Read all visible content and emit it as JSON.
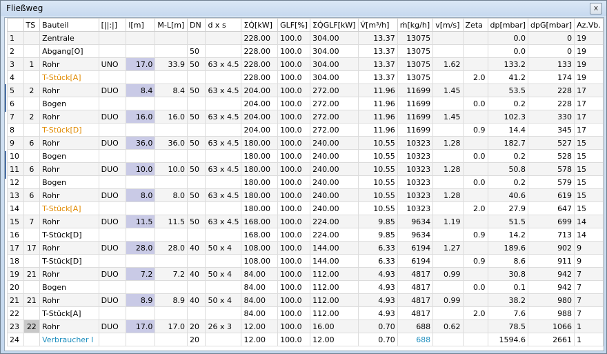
{
  "window": {
    "title": "Fließweg",
    "close_label": "x"
  },
  "columns": [
    "",
    "TS",
    "Bauteil",
    "[||:|]",
    "l[m]",
    "M-L[m]",
    "DN",
    "d x s",
    "ΣQ̇[kW]",
    "GLF[%]",
    "ΣQ̇GLF[kW]",
    "V̇[m³/h]",
    "ṁ[kg/h]",
    "v[m/s]",
    "Zeta",
    "dp[mbar]",
    "dpG[mbar]",
    "Az.Vb."
  ],
  "rows": [
    {
      "nr": "1",
      "ts": "",
      "bauteil": "Zentrale",
      "typ": "",
      "l": "",
      "ml": "",
      "dn": "",
      "dxs": "",
      "q": "228.00",
      "glf": "100.0",
      "qglf": "304.00",
      "v": "13.37",
      "m": "13075",
      "vel": "",
      "zeta": "",
      "dp": "0.0",
      "dpg": "0",
      "az": "19"
    },
    {
      "nr": "2",
      "ts": "",
      "bauteil": "Abgang[O]",
      "typ": "",
      "l": "",
      "ml": "",
      "dn": "50",
      "dxs": "",
      "q": "228.00",
      "glf": "100.0",
      "qglf": "304.00",
      "v": "13.37",
      "m": "13075",
      "vel": "",
      "zeta": "",
      "dp": "0.0",
      "dpg": "0",
      "az": "19"
    },
    {
      "nr": "3",
      "ts": "1",
      "bauteil": "Rohr",
      "typ": "UNO",
      "l": "17.0",
      "ml": "33.9",
      "dn": "50",
      "dxs": "63 x 4.5",
      "q": "228.00",
      "glf": "100.0",
      "qglf": "304.00",
      "v": "13.37",
      "m": "13075",
      "vel": "1.62",
      "zeta": "",
      "dp": "133.2",
      "dpg": "133",
      "az": "19"
    },
    {
      "nr": "4",
      "ts": "",
      "bauteil": "T-Stück[A]",
      "color": "orange",
      "typ": "",
      "l": "",
      "ml": "",
      "dn": "",
      "dxs": "",
      "q": "228.00",
      "glf": "100.0",
      "qglf": "304.00",
      "v": "13.37",
      "m": "13075",
      "vel": "",
      "zeta": "2.0",
      "dp": "41.2",
      "dpg": "174",
      "az": "19"
    },
    {
      "nr": "5",
      "ts": "2",
      "bauteil": "Rohr",
      "typ": "DUO",
      "l": "8.4",
      "ml": "8.4",
      "dn": "50",
      "dxs": "63 x 4.5",
      "q": "204.00",
      "glf": "100.0",
      "qglf": "272.00",
      "v": "11.96",
      "m": "11699",
      "vel": "1.45",
      "zeta": "",
      "dp": "53.5",
      "dpg": "228",
      "az": "17"
    },
    {
      "nr": "6",
      "ts": "",
      "bauteil": "Bogen",
      "typ": "",
      "l": "",
      "ml": "",
      "dn": "",
      "dxs": "",
      "q": "204.00",
      "glf": "100.0",
      "qglf": "272.00",
      "v": "11.96",
      "m": "11699",
      "vel": "",
      "zeta": "0.0",
      "dp": "0.2",
      "dpg": "228",
      "az": "17"
    },
    {
      "nr": "7",
      "ts": "2",
      "bauteil": "Rohr",
      "typ": "DUO",
      "l": "16.0",
      "ml": "16.0",
      "dn": "50",
      "dxs": "63 x 4.5",
      "q": "204.00",
      "glf": "100.0",
      "qglf": "272.00",
      "v": "11.96",
      "m": "11699",
      "vel": "1.45",
      "zeta": "",
      "dp": "102.3",
      "dpg": "330",
      "az": "17"
    },
    {
      "nr": "8",
      "ts": "",
      "bauteil": "T-Stück[D]",
      "color": "orange",
      "typ": "",
      "l": "",
      "ml": "",
      "dn": "",
      "dxs": "",
      "q": "204.00",
      "glf": "100.0",
      "qglf": "272.00",
      "v": "11.96",
      "m": "11699",
      "vel": "",
      "zeta": "0.9",
      "dp": "14.4",
      "dpg": "345",
      "az": "17"
    },
    {
      "nr": "9",
      "ts": "6",
      "bauteil": "Rohr",
      "typ": "DUO",
      "l": "36.0",
      "ml": "36.0",
      "dn": "50",
      "dxs": "63 x 4.5",
      "q": "180.00",
      "glf": "100.0",
      "qglf": "240.00",
      "v": "10.55",
      "m": "10323",
      "vel": "1.28",
      "zeta": "",
      "dp": "182.7",
      "dpg": "527",
      "az": "15"
    },
    {
      "nr": "10",
      "ts": "",
      "bauteil": "Bogen",
      "typ": "",
      "l": "",
      "ml": "",
      "dn": "",
      "dxs": "",
      "q": "180.00",
      "glf": "100.0",
      "qglf": "240.00",
      "v": "10.55",
      "m": "10323",
      "vel": "",
      "zeta": "0.0",
      "dp": "0.2",
      "dpg": "528",
      "az": "15"
    },
    {
      "nr": "11",
      "ts": "6",
      "bauteil": "Rohr",
      "typ": "DUO",
      "l": "10.0",
      "ml": "10.0",
      "dn": "50",
      "dxs": "63 x 4.5",
      "q": "180.00",
      "glf": "100.0",
      "qglf": "240.00",
      "v": "10.55",
      "m": "10323",
      "vel": "1.28",
      "zeta": "",
      "dp": "50.8",
      "dpg": "578",
      "az": "15"
    },
    {
      "nr": "12",
      "ts": "",
      "bauteil": "Bogen",
      "typ": "",
      "l": "",
      "ml": "",
      "dn": "",
      "dxs": "",
      "q": "180.00",
      "glf": "100.0",
      "qglf": "240.00",
      "v": "10.55",
      "m": "10323",
      "vel": "",
      "zeta": "0.0",
      "dp": "0.2",
      "dpg": "579",
      "az": "15"
    },
    {
      "nr": "13",
      "ts": "6",
      "bauteil": "Rohr",
      "typ": "DUO",
      "l": "8.0",
      "ml": "8.0",
      "dn": "50",
      "dxs": "63 x 4.5",
      "q": "180.00",
      "glf": "100.0",
      "qglf": "240.00",
      "v": "10.55",
      "m": "10323",
      "vel": "1.28",
      "zeta": "",
      "dp": "40.6",
      "dpg": "619",
      "az": "15"
    },
    {
      "nr": "14",
      "ts": "",
      "bauteil": "T-Stück[A]",
      "color": "orange",
      "typ": "",
      "l": "",
      "ml": "",
      "dn": "",
      "dxs": "",
      "q": "180.00",
      "glf": "100.0",
      "qglf": "240.00",
      "v": "10.55",
      "m": "10323",
      "vel": "",
      "zeta": "2.0",
      "dp": "27.9",
      "dpg": "647",
      "az": "15"
    },
    {
      "nr": "15",
      "ts": "7",
      "bauteil": "Rohr",
      "typ": "DUO",
      "l": "11.5",
      "ml": "11.5",
      "dn": "50",
      "dxs": "63 x 4.5",
      "q": "168.00",
      "glf": "100.0",
      "qglf": "224.00",
      "v": "9.85",
      "m": "9634",
      "vel": "1.19",
      "zeta": "",
      "dp": "51.5",
      "dpg": "699",
      "az": "14"
    },
    {
      "nr": "16",
      "ts": "",
      "bauteil": "T-Stück[D]",
      "typ": "",
      "l": "",
      "ml": "",
      "dn": "",
      "dxs": "",
      "q": "168.00",
      "glf": "100.0",
      "qglf": "224.00",
      "v": "9.85",
      "m": "9634",
      "vel": "",
      "zeta": "0.9",
      "dp": "14.2",
      "dpg": "713",
      "az": "14"
    },
    {
      "nr": "17",
      "ts": "17",
      "bauteil": "Rohr",
      "typ": "DUO",
      "l": "28.0",
      "ml": "28.0",
      "dn": "40",
      "dxs": "50 x 4",
      "q": "108.00",
      "glf": "100.0",
      "qglf": "144.00",
      "v": "6.33",
      "m": "6194",
      "vel": "1.27",
      "zeta": "",
      "dp": "189.6",
      "dpg": "902",
      "az": "9"
    },
    {
      "nr": "18",
      "ts": "",
      "bauteil": "T-Stück[D]",
      "typ": "",
      "l": "",
      "ml": "",
      "dn": "",
      "dxs": "",
      "q": "108.00",
      "glf": "100.0",
      "qglf": "144.00",
      "v": "6.33",
      "m": "6194",
      "vel": "",
      "zeta": "0.9",
      "dp": "8.6",
      "dpg": "911",
      "az": "9"
    },
    {
      "nr": "19",
      "ts": "21",
      "bauteil": "Rohr",
      "typ": "DUO",
      "l": "7.2",
      "ml": "7.2",
      "dn": "40",
      "dxs": "50 x 4",
      "q": "84.00",
      "glf": "100.0",
      "qglf": "112.00",
      "v": "4.93",
      "m": "4817",
      "vel": "0.99",
      "zeta": "",
      "dp": "30.8",
      "dpg": "942",
      "az": "7"
    },
    {
      "nr": "20",
      "ts": "",
      "bauteil": "Bogen",
      "typ": "",
      "l": "",
      "ml": "",
      "dn": "",
      "dxs": "",
      "q": "84.00",
      "glf": "100.0",
      "qglf": "112.00",
      "v": "4.93",
      "m": "4817",
      "vel": "",
      "zeta": "0.0",
      "dp": "0.1",
      "dpg": "942",
      "az": "7"
    },
    {
      "nr": "21",
      "ts": "21",
      "bauteil": "Rohr",
      "typ": "DUO",
      "l": "8.9",
      "ml": "8.9",
      "dn": "40",
      "dxs": "50 x 4",
      "q": "84.00",
      "glf": "100.0",
      "qglf": "112.00",
      "v": "4.93",
      "m": "4817",
      "vel": "0.99",
      "zeta": "",
      "dp": "38.2",
      "dpg": "980",
      "az": "7"
    },
    {
      "nr": "22",
      "ts": "",
      "bauteil": "T-Stück[A]",
      "typ": "",
      "l": "",
      "ml": "",
      "dn": "",
      "dxs": "",
      "q": "84.00",
      "glf": "100.0",
      "qglf": "112.00",
      "v": "4.93",
      "m": "4817",
      "vel": "",
      "zeta": "2.0",
      "dp": "7.6",
      "dpg": "988",
      "az": "7"
    },
    {
      "nr": "23",
      "ts": "22",
      "ts_selected": true,
      "bauteil": "Rohr",
      "typ": "DUO",
      "l": "17.0",
      "ml": "17.0",
      "dn": "20",
      "dxs": "26 x 3",
      "q": "12.00",
      "glf": "100.0",
      "qglf": "16.00",
      "v": "0.70",
      "m": "688",
      "vel": "0.62",
      "zeta": "",
      "dp": "78.5",
      "dpg": "1066",
      "az": "1"
    },
    {
      "nr": "24",
      "ts": "",
      "bauteil": "Verbraucher I",
      "color": "cyan",
      "m_color": "cyan",
      "typ": "",
      "l": "",
      "ml": "",
      "dn": "20",
      "dxs": "",
      "q": "12.00",
      "glf": "100.0",
      "qglf": "12.00",
      "v": "0.70",
      "m": "688",
      "vel": "",
      "zeta": "",
      "dp": "1594.6",
      "dpg": "2661",
      "az": "1"
    }
  ],
  "colors": {
    "length_cell": "#c9cae6",
    "orange_text": "#e08a00",
    "cyan_text": "#1f8fbf"
  }
}
